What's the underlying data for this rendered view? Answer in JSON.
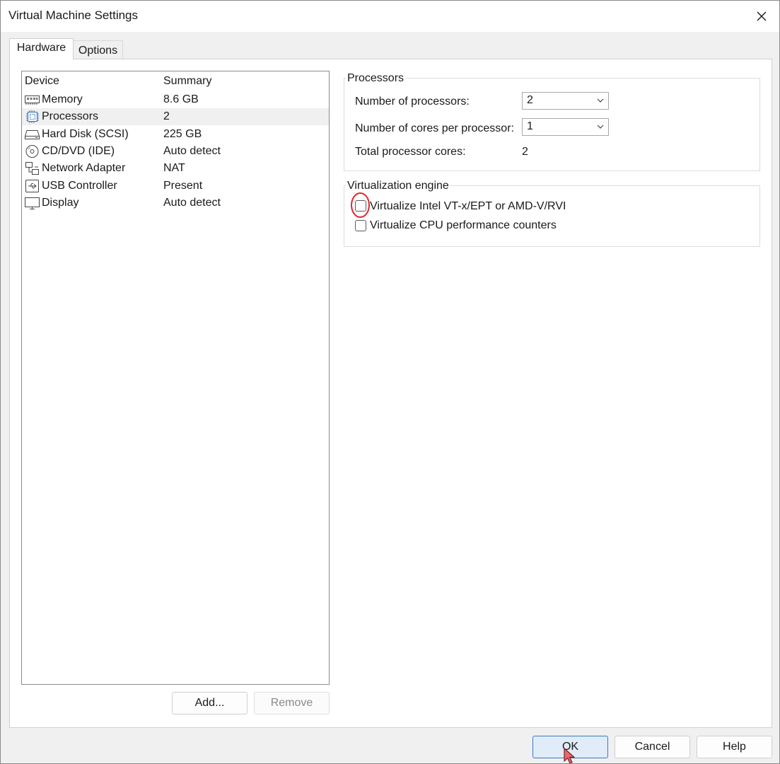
{
  "window": {
    "title": "Virtual Machine Settings"
  },
  "tabs": [
    {
      "label": "Hardware",
      "active": true
    },
    {
      "label": "Options",
      "active": false
    }
  ],
  "device_list": {
    "headers": {
      "device": "Device",
      "summary": "Summary"
    },
    "rows": [
      {
        "name": "Memory",
        "summary": "8.6 GB",
        "icon": "memory-icon",
        "selected": false
      },
      {
        "name": "Processors",
        "summary": "2",
        "icon": "processor-icon",
        "selected": true
      },
      {
        "name": "Hard Disk (SCSI)",
        "summary": "225 GB",
        "icon": "hard-disk-icon",
        "selected": false
      },
      {
        "name": "CD/DVD (IDE)",
        "summary": "Auto detect",
        "icon": "cd-dvd-icon",
        "selected": false
      },
      {
        "name": "Network Adapter",
        "summary": "NAT",
        "icon": "network-adapter-icon",
        "selected": false
      },
      {
        "name": "USB Controller",
        "summary": "Present",
        "icon": "usb-icon",
        "selected": false
      },
      {
        "name": "Display",
        "summary": "Auto detect",
        "icon": "display-icon",
        "selected": false
      }
    ]
  },
  "list_buttons": {
    "add": "Add...",
    "remove": "Remove"
  },
  "processors_group": {
    "title": "Processors",
    "num_processors_label": "Number of processors:",
    "num_processors_value": "2",
    "cores_label": "Number of cores per processor:",
    "cores_value": "1",
    "total_label": "Total processor cores:",
    "total_value": "2"
  },
  "virtualization_group": {
    "title": "Virtualization engine",
    "vtx_label": "Virtualize Intel VT-x/EPT or AMD-V/RVI",
    "vtx_checked": false,
    "perf_label": "Virtualize CPU performance counters",
    "perf_checked": false
  },
  "footer_buttons": {
    "ok": "OK",
    "cancel": "Cancel",
    "help": "Help"
  },
  "colors": {
    "selected_row": "#f0f0f0",
    "primary_button_border": "#3a78c4",
    "annotation": "#e0262b",
    "cursor": "#e8696b"
  }
}
